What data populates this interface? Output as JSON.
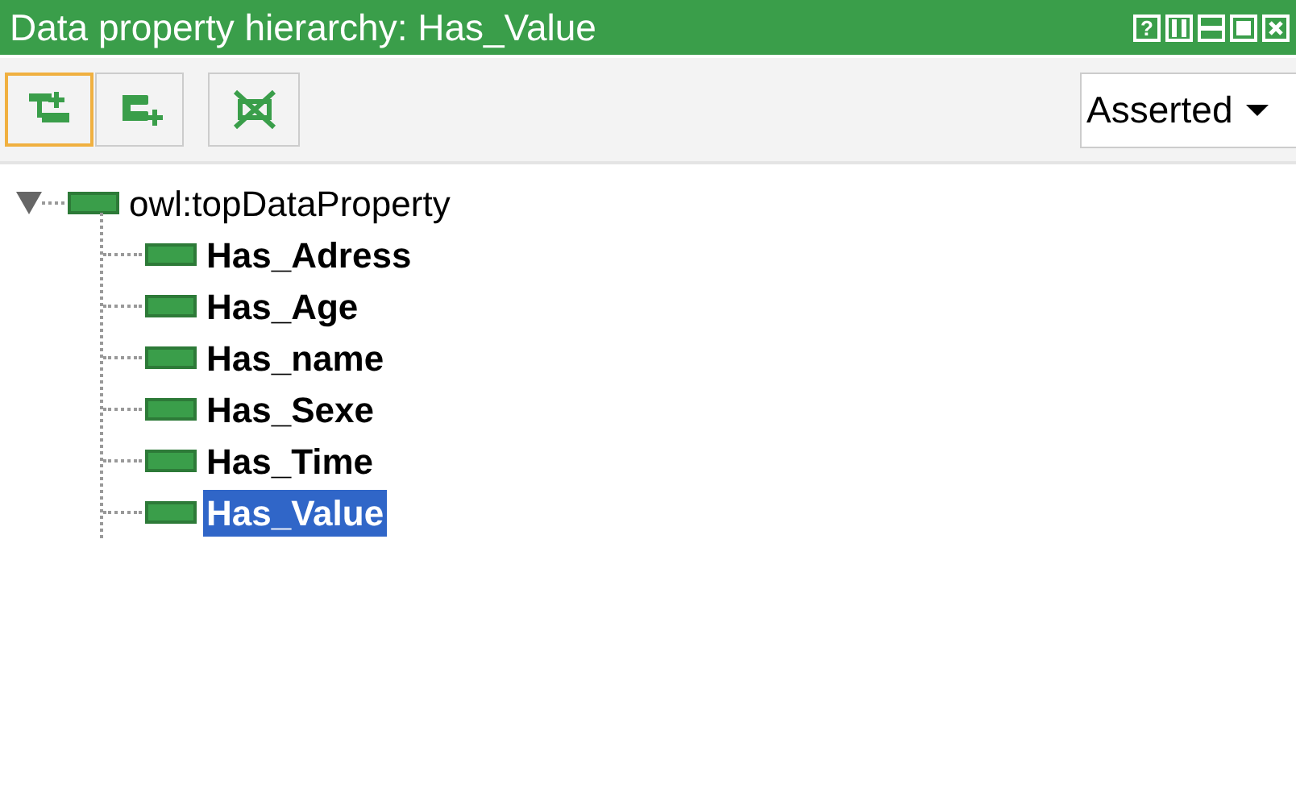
{
  "window": {
    "title": "Data property hierarchy: Has_Value",
    "controls": [
      "?"
    ]
  },
  "toolbar": {
    "buttons": [
      {
        "kind": "add-sub",
        "selected": true
      },
      {
        "kind": "add-sibling",
        "selected": false
      },
      {
        "kind": "delete",
        "selected": false
      }
    ],
    "dropdown": {
      "value": "Asserted"
    }
  },
  "tree": {
    "label": "owl:topDataProperty",
    "expanded": true,
    "children": [
      {
        "label": "Has_Adress",
        "selected": false
      },
      {
        "label": "Has_Age",
        "selected": false
      },
      {
        "label": "Has_name",
        "selected": false
      },
      {
        "label": "Has_Sexe",
        "selected": false
      },
      {
        "label": "Has_Time",
        "selected": false
      },
      {
        "label": "Has_Value",
        "selected": true
      }
    ]
  }
}
